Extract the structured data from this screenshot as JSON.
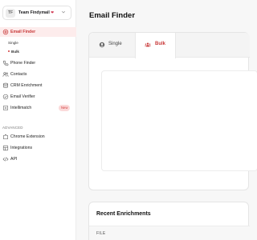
{
  "team": {
    "avatar_initials": "TF",
    "name": "Team Findymail",
    "emoji": "❤"
  },
  "nav": {
    "email_finder": "Email Finder",
    "sub_single": "Single",
    "sub_bulk": "Bulk",
    "phone_finder": "Phone Finder",
    "contacts": "Contacts",
    "crm_enrichment": "CRM Enrichment",
    "email_verifier": "Email Verifier",
    "intellimatch": "Intellimatch",
    "intellimatch_badge": "New"
  },
  "advanced": {
    "label": "ADVANCED",
    "chrome_extension": "Chrome Extension",
    "integrations": "Integrations",
    "api": "API"
  },
  "main": {
    "title": "Email Finder",
    "tabs": [
      {
        "label": "Single",
        "icon": "user-icon",
        "active": false
      },
      {
        "label": "Bulk",
        "icon": "users-icon",
        "active": true
      }
    ]
  },
  "enrichments": {
    "title": "Recent Enrichments",
    "columns": [
      "FILE"
    ]
  },
  "colors": {
    "accent": "#d23c3c",
    "active_bg": "#fdecec"
  }
}
